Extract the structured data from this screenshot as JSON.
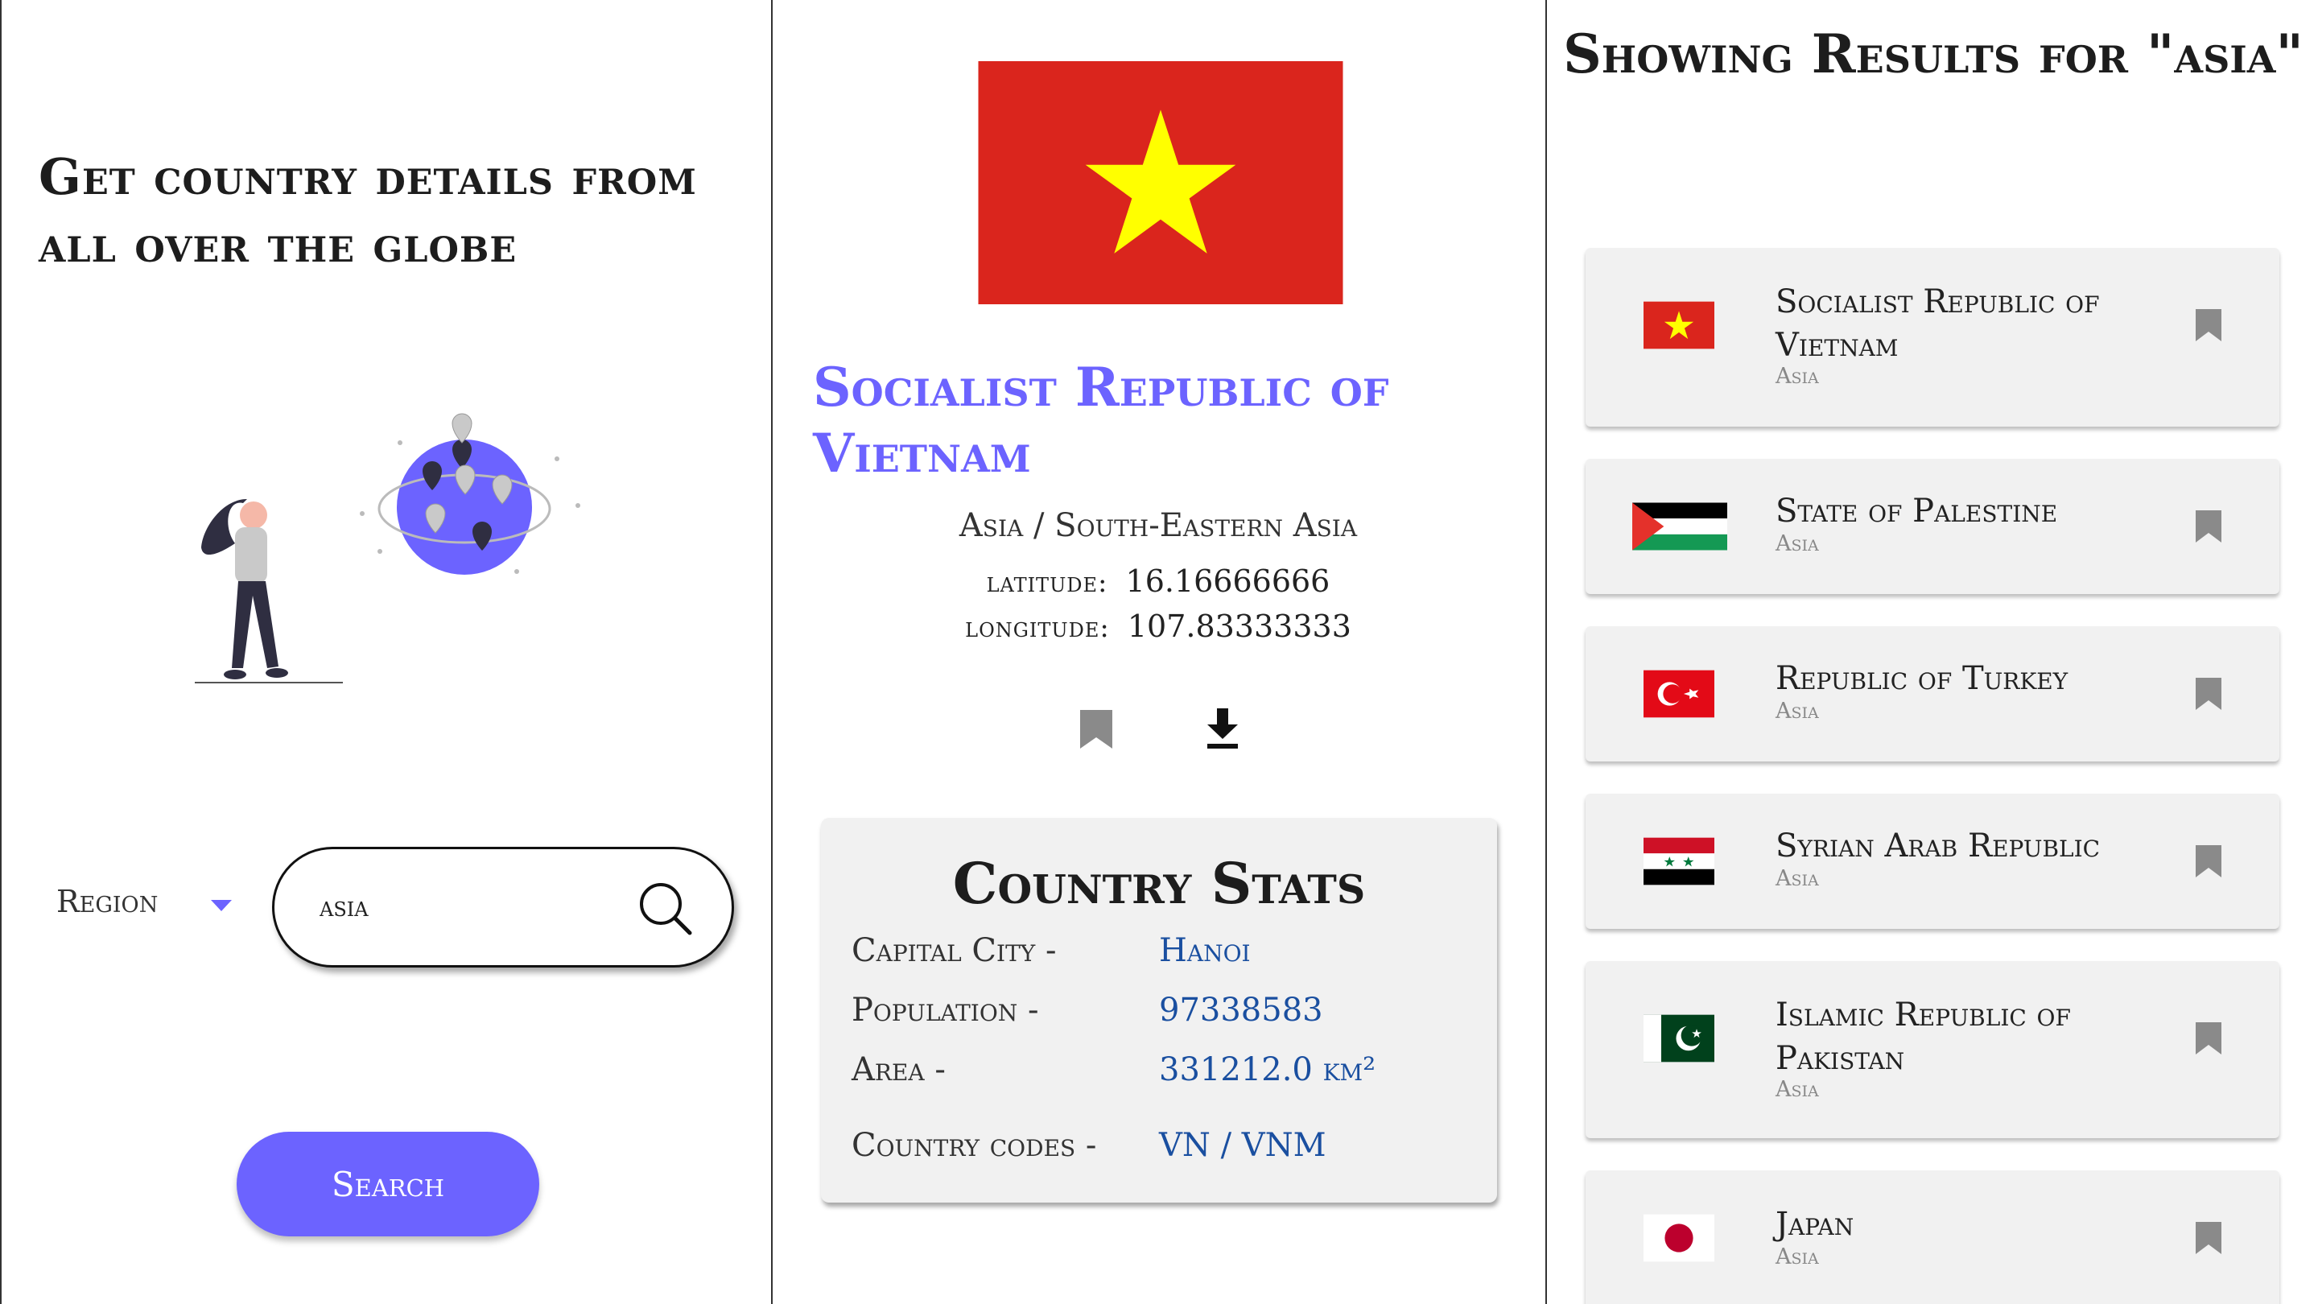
{
  "left_panel": {
    "headline": "Get country details from all over the globe",
    "region_label": "Region",
    "search_value": "asia",
    "search_button": "Search"
  },
  "detail": {
    "name": "Socialist Republic of Vietnam",
    "subregion": "Asia / South-Eastern Asia",
    "latitude_label": "latitude:",
    "latitude": "16.16666666",
    "longitude_label": "longitude:",
    "longitude": "107.83333333",
    "stats": {
      "title": "Country Stats",
      "capital_label": "Capital City -",
      "capital": "Hanoi",
      "population_label": "Population -",
      "population": "97338583",
      "area_label": "Area -",
      "area": "331212.0 km²",
      "codes_label": "Country codes -",
      "codes": "VN / VNM"
    }
  },
  "results": {
    "title": "Showing Results for \"asia\"",
    "items": [
      {
        "name": "Socialist Republic of Vietnam",
        "region": "Asia",
        "flag": "vietnam-flag"
      },
      {
        "name": "State of Palestine",
        "region": "Asia",
        "flag": "palestine-flag"
      },
      {
        "name": "Republic of Turkey",
        "region": "Asia",
        "flag": "turkey-flag"
      },
      {
        "name": "Syrian Arab Republic",
        "region": "Asia",
        "flag": "syria-flag"
      },
      {
        "name": "Islamic Republic of Pakistan",
        "region": "Asia",
        "flag": "pakistan-flag"
      },
      {
        "name": "Japan",
        "region": "Asia",
        "flag": "japan-flag"
      }
    ]
  },
  "colors": {
    "accent": "#6C63FF",
    "stat_value": "#1a4fa0",
    "card_bg": "#f1f1f1"
  }
}
